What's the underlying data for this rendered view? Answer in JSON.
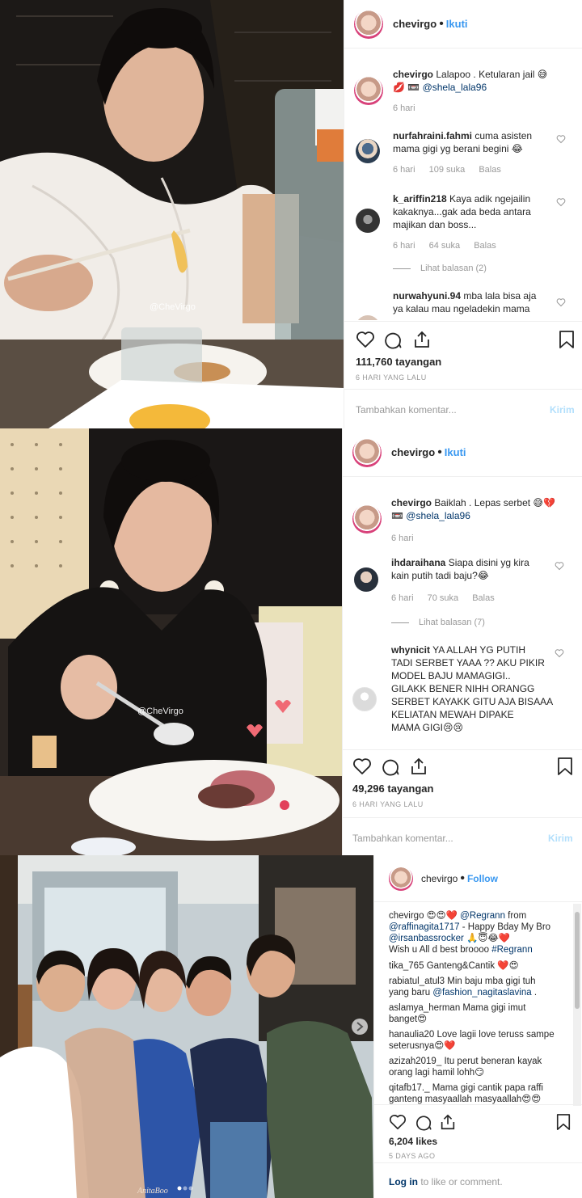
{
  "post1": {
    "username": "chevirgo",
    "follow": "Ikuti",
    "watermark": "@CheVirgo",
    "caption": {
      "user": "chevirgo",
      "text": "Lalapoo . Ketularan jail 😅",
      "emoji2": "💋 📼",
      "mention": "@shela_lala96",
      "time": "6 hari"
    },
    "comments": [
      {
        "user": "nurfahraini.fahmi",
        "line1": "cuma asisten",
        "line2": "mama gigi yg berani begini 😂",
        "time": "6 hari",
        "likes": "109 suka",
        "reply": "Balas"
      },
      {
        "user": "k_ariffin218",
        "line1": "Kaya adik ngejailin",
        "line2": "kakaknya...gak ada beda antara",
        "line3": "majikan dan boss...",
        "time": "6 hari",
        "likes": "64 suka",
        "reply": "Balas"
      },
      {
        "user": "nurwahyuni.94",
        "line1": "mba lala bisa aja",
        "line2": "ya kalau mau ngeladekin mama"
      }
    ],
    "view_replies": "Lihat balasan (2)",
    "views": "111,760 tayangan",
    "ago": "6 HARI YANG LALU",
    "add_comment": "Tambahkan komentar...",
    "send": "Kirim"
  },
  "post2": {
    "username": "chevirgo",
    "follow": "Ikuti",
    "watermark": "@CheVirgo",
    "caption": {
      "user": "chevirgo",
      "text": "Baiklah . Lepas serbet 😅💔",
      "emoji2": "📼",
      "mention": "@shela_lala96",
      "time": "6 hari"
    },
    "comments": [
      {
        "user": "ihdaraihana",
        "line1": "Siapa disini yg kira",
        "line2": "kain putih tadi baju?😂",
        "time": "6 hari",
        "likes": "70 suka",
        "reply": "Balas"
      },
      {
        "user": "whynicit",
        "line1": "YA ALLAH YG PUTIH",
        "line2": "TADI SERBET YAAA ?? AKU PIKIR",
        "line3": "MODEL BAJU MAMAGIGI..",
        "line4": "GILAKK BENER NIHH ORANGG",
        "line5": "SERBET KAYAKK GITU AJA BISAAA",
        "line6": "KELIATAN MEWAH DIPAKE",
        "line7": "MAMA GIGI😢😢"
      }
    ],
    "view_replies": "Lihat balasan (7)",
    "views": "49,296 tayangan",
    "ago": "6 HARI YANG LALU",
    "add_comment": "Tambahkan komentar...",
    "send": "Kirim"
  },
  "post3": {
    "username": "chevirgo",
    "follow": "Follow",
    "watermark": "AnitaBoo",
    "caption": {
      "user": "chevirgo",
      "text": "😍😍❤️",
      "mention1": "@Regrann",
      "t2": "from",
      "mention2": "@raffinagita1717",
      "t3": "- Happy Bday My Bro",
      "mention3": "@irsanbassrocker",
      "t4": "🙏😇😂❤️",
      "t5": "Wish u All d best broooo",
      "hashtag": "#Regrann"
    },
    "comments": [
      {
        "user": "tika_765",
        "text": "Ganteng&Cantik ❤️😍"
      },
      {
        "user": "rabiatul_atul3",
        "text": "Min baju mba gigi tuh",
        "line2": "yang baru",
        "mention": "@fashion_nagitaslavina",
        "tail": "."
      },
      {
        "user": "aslamya_herman",
        "text": "Mama gigi imut",
        "line2": "banget😍"
      },
      {
        "user": "hanaulia20",
        "text": "Love lagii love teruss sampe",
        "line2": "seterusnya😍❤️"
      },
      {
        "user": "azizah2019_",
        "text": "Itu perut beneran kayak",
        "line2": "orang lagi hamil lohh😏"
      },
      {
        "user": "qitafb17._",
        "text": "Mama gigi cantik papa raffi",
        "line2": "ganteng masyaallah masyaallah😍😍"
      }
    ],
    "likes": "6,204 likes",
    "ago": "5 DAYS AGO",
    "login": "Log in",
    "login_rest": "to like or comment."
  },
  "colors": {
    "accent": "#3897f0",
    "mention": "#003569",
    "meta": "#999999",
    "send_disabled": "#b2dffc"
  }
}
